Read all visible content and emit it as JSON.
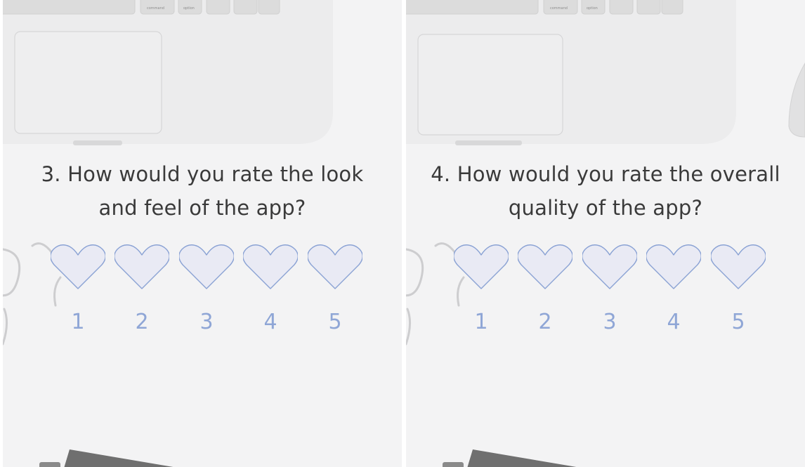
{
  "screens": [
    {
      "question_line1": "3. How would you rate the look",
      "question_line2": "and feel of the app?",
      "ratings": [
        "1",
        "2",
        "3",
        "4",
        "5"
      ]
    },
    {
      "question_line1": "4. How would you rate the overall",
      "question_line2": "quality of the app?",
      "ratings": [
        "1",
        "2",
        "3",
        "4",
        "5"
      ]
    }
  ],
  "keyboard_keys": [
    "command",
    "option"
  ],
  "icons": {
    "rating_option": "heart-outline-icon"
  },
  "colors": {
    "background": "#f3f3f4",
    "question_text": "#3a3a3a",
    "heart_stroke": "#8aa2d4",
    "heart_fill": "#e9eaf4",
    "number_text": "#8fa6d6"
  }
}
